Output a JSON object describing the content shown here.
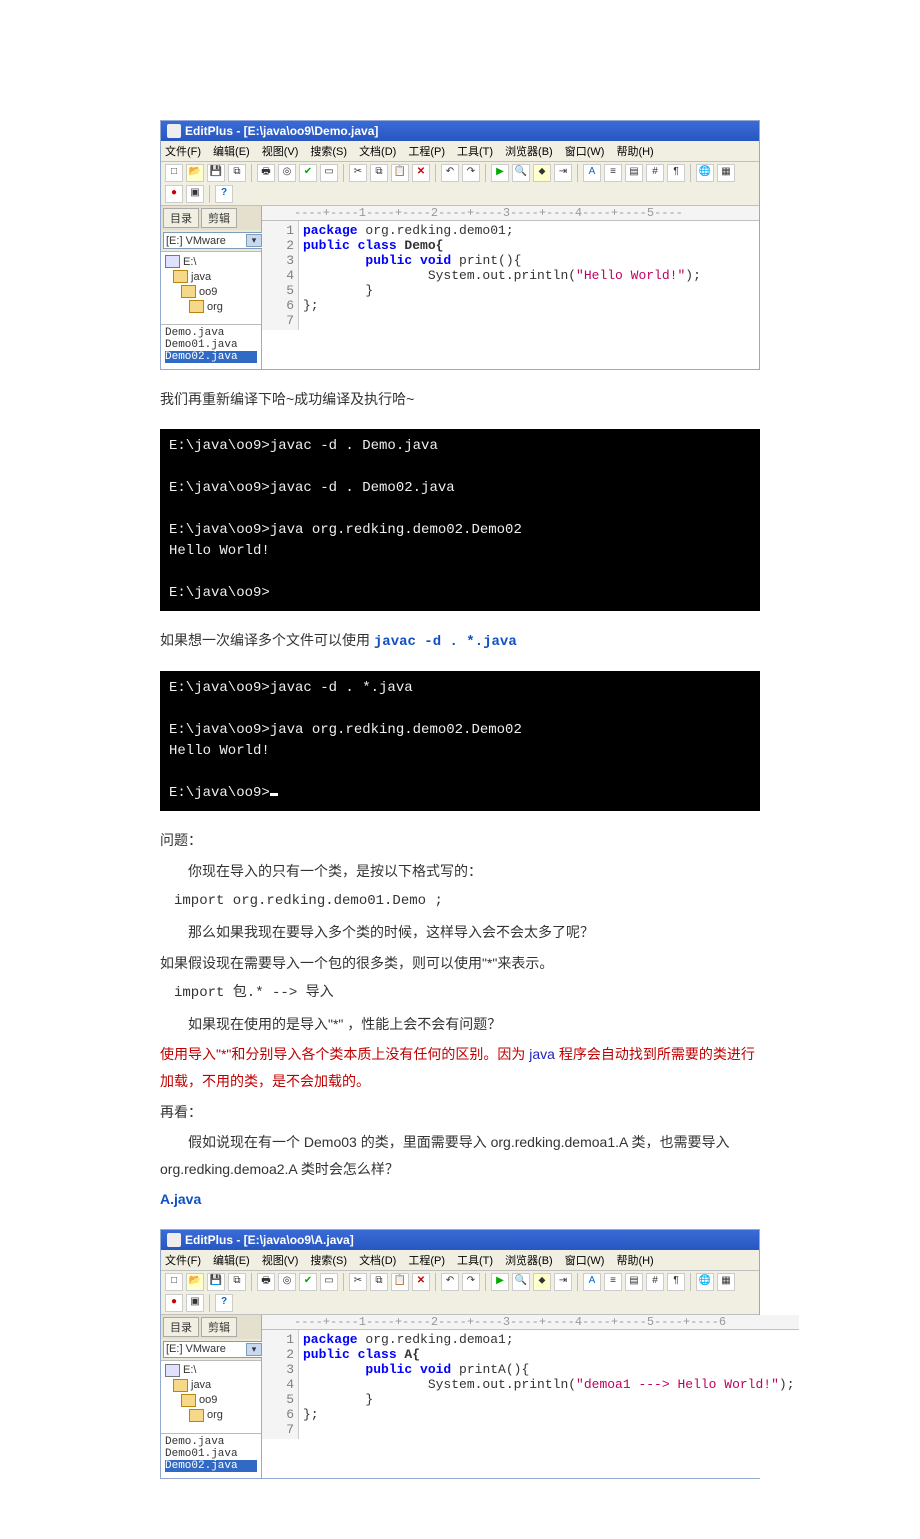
{
  "editor1": {
    "titlebar": "EditPlus - [E:\\java\\oo9\\Demo.java]",
    "menu": [
      "文件(F)",
      "编辑(E)",
      "视图(V)",
      "搜索(S)",
      "文档(D)",
      "工程(P)",
      "工具(T)",
      "浏览器(B)",
      "窗口(W)",
      "帮助(H)"
    ],
    "side": {
      "tabs": [
        "目录",
        "剪辑"
      ],
      "select": "[E:] VMware",
      "tree": [
        "E:\\",
        "java",
        "oo9",
        "org"
      ],
      "files": [
        "Demo.java",
        "Demo01.java",
        "Demo02.java"
      ],
      "selected": 2
    },
    "ruler": "----+----1----+----2----+----3----+----4----+----5----",
    "gutter": "1\n2\n3\n4\n5\n6\n7",
    "code": {
      "l1_pre": "package",
      "l1_post": " org.redking.demo01;",
      "l2_pre": "public class",
      "l2_post": " Demo{",
      "l3_pre": "        public void",
      "l3_post": " print(){",
      "l4_pre": "                System.out.println(",
      "l4_str": "\"Hello World!\"",
      "l4_post": ");",
      "l5": "        }",
      "l6": "};",
      "l7": ""
    }
  },
  "para1": "我们再重新编译下哈~成功编译及执行哈~",
  "terminal1": "E:\\java\\oo9>javac -d . Demo.java\n\nE:\\java\\oo9>javac -d . Demo02.java\n\nE:\\java\\oo9>java org.redking.demo02.Demo02\nHello World!\n\nE:\\java\\oo9>",
  "para2_pre": "如果想一次编译多个文件可以使用 ",
  "para2_cmd": "javac -d . *.java",
  "terminal2": "E:\\java\\oo9>javac -d . *.java\n\nE:\\java\\oo9>java org.redking.demo02.Demo02\nHello World!\n\nE:\\java\\oo9>",
  "q_heading": "问题：",
  "q_l1": "你现在导入的只有一个类，是按以下格式写的：",
  "q_import1": " import  org.redking.demo01.Demo ;",
  "q_l2": "那么如果我现在要导入多个类的时候，这样导入会不会太多了呢？",
  "q_l3": "如果假设现在需要导入一个包的很多类，则可以使用\"*\"来表示。",
  "q_import2": "import  包.*   -->  导入",
  "q_l4": "如果现在使用的是导入\"*\" ，性能上会不会有问题？",
  "q_red_pre": " 使用导入\"*\"和分别导入各个类本质上没有任何的区别。因为 ",
  "q_red_java": "java ",
  "q_red_post1": "程序会自动找到所需要的类进行加载，不用的类，是不会加载的。",
  "q_again": "再看：",
  "q_l5a": "假如说现在有一个 Demo03  的类，里面需要导入 org.redking.demoa1.A  类，也需要导入org.redking.demoa2.A 类时会怎么样？",
  "a_label": "A.java",
  "editor2": {
    "titlebar": "EditPlus - [E:\\java\\oo9\\A.java]",
    "menu": [
      "文件(F)",
      "编辑(E)",
      "视图(V)",
      "搜索(S)",
      "文档(D)",
      "工程(P)",
      "工具(T)",
      "浏览器(B)",
      "窗口(W)",
      "帮助(H)"
    ],
    "side": {
      "tabs": [
        "目录",
        "剪辑"
      ],
      "select": "[E:] VMware",
      "tree": [
        "E:\\",
        "java",
        "oo9",
        "org"
      ],
      "files": [
        "Demo.java",
        "Demo01.java",
        "Demo02.java"
      ],
      "selected": 2
    },
    "ruler": "----+----1----+----2----+----3----+----4----+----5----+----6",
    "gutter": "1\n2\n3\n4\n5\n6\n7",
    "code": {
      "l1_pre": "package",
      "l1_post": " org.redking.demoa1;",
      "l2_pre": "public class",
      "l2_post": " A{",
      "l3_pre": "        public void",
      "l3_post": " printA(){",
      "l4_pre": "                System.out.println(",
      "l4_str": "\"demoa1 ---> Hello World!\"",
      "l4_post": ");",
      "l5": "        }",
      "l6": "};",
      "l7": ""
    }
  }
}
